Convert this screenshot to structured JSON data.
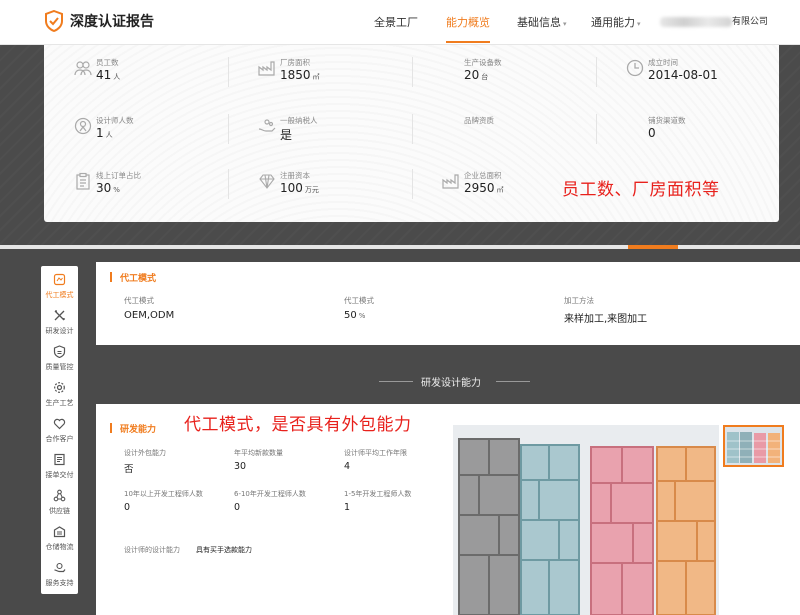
{
  "brand": {
    "name": "深度认证报告",
    "accent": "#f07c1e"
  },
  "nav": [
    {
      "label": "全景工厂"
    },
    {
      "label": "能力概览",
      "active": true
    },
    {
      "label": "基础信息",
      "has_dropdown": true
    },
    {
      "label": "通用能力",
      "has_dropdown": true
    }
  ],
  "company": {
    "name_visible_suffix": "有限公司"
  },
  "stats": [
    {
      "label": "员工数",
      "value": "41",
      "unit": "人",
      "icon": "people-icon"
    },
    {
      "label": "厂房面积",
      "value": "1850",
      "unit": "㎡",
      "icon": "factory-icon"
    },
    {
      "label": "生产设备数",
      "value": "20",
      "unit": "台",
      "icon": "equipment-icon"
    },
    {
      "label": "成立时间",
      "value": "2014-08-01",
      "unit": "",
      "icon": "clock-icon"
    },
    {
      "label": "设计师人数",
      "value": "1",
      "unit": "人",
      "icon": "designer-icon"
    },
    {
      "label": "一般纳税人",
      "value": "是",
      "unit": "",
      "icon": "taxpayer-icon"
    },
    {
      "label": "品牌资质",
      "value": "",
      "unit": "",
      "icon": ""
    },
    {
      "label": "铺货渠道数",
      "value": "0",
      "unit": "",
      "icon": ""
    },
    {
      "label": "线上订单占比",
      "value": "30",
      "unit": "%",
      "icon": "clipboard-icon"
    },
    {
      "label": "注册资本",
      "value": "100",
      "unit": "万元",
      "icon": "diamond-icon"
    },
    {
      "label": "企业总面积",
      "value": "2950",
      "unit": "㎡",
      "icon": "building-icon"
    }
  ],
  "annotations": {
    "top": "员工数、厂房面积等",
    "middle": "代工模式，是否具有外包能力"
  },
  "sidebar": [
    {
      "label": "代工模式",
      "icon": "oem-icon",
      "active": true
    },
    {
      "label": "研发设计",
      "icon": "design-tools-icon"
    },
    {
      "label": "质量管控",
      "icon": "quality-shield-icon"
    },
    {
      "label": "生产工艺",
      "icon": "gear-icon"
    },
    {
      "label": "合作客户",
      "icon": "handshake-icon"
    },
    {
      "label": "接单交付",
      "icon": "order-icon"
    },
    {
      "label": "供应链",
      "icon": "supply-chain-icon"
    },
    {
      "label": "仓储物流",
      "icon": "warehouse-icon"
    },
    {
      "label": "服务支持",
      "icon": "service-icon"
    }
  ],
  "oem": {
    "title": "代工模式",
    "fields": [
      {
        "label": "代工模式",
        "value": "OEM,ODM",
        "unit": ""
      },
      {
        "label": "代工模式",
        "value": "50",
        "unit": "%"
      },
      {
        "label": "加工方法",
        "value": "来样加工,来图加工",
        "unit": ""
      }
    ]
  },
  "section_divider": "研发设计能力",
  "rd": {
    "title": "研发能力",
    "fields": [
      {
        "label": "设计外包能力",
        "value": "否"
      },
      {
        "label": "年平均新款数量",
        "value": "30"
      },
      {
        "label": "设计师平均工作年限",
        "value": "4"
      },
      {
        "label": "10年以上开发工程师人数",
        "value": "0"
      },
      {
        "label": "6-10年开发工程师人数",
        "value": "0"
      },
      {
        "label": "1-5年开发工程师人数",
        "value": "1"
      },
      {
        "label": "设计师的设计能力",
        "value": "具有买手选款能力"
      }
    ]
  }
}
